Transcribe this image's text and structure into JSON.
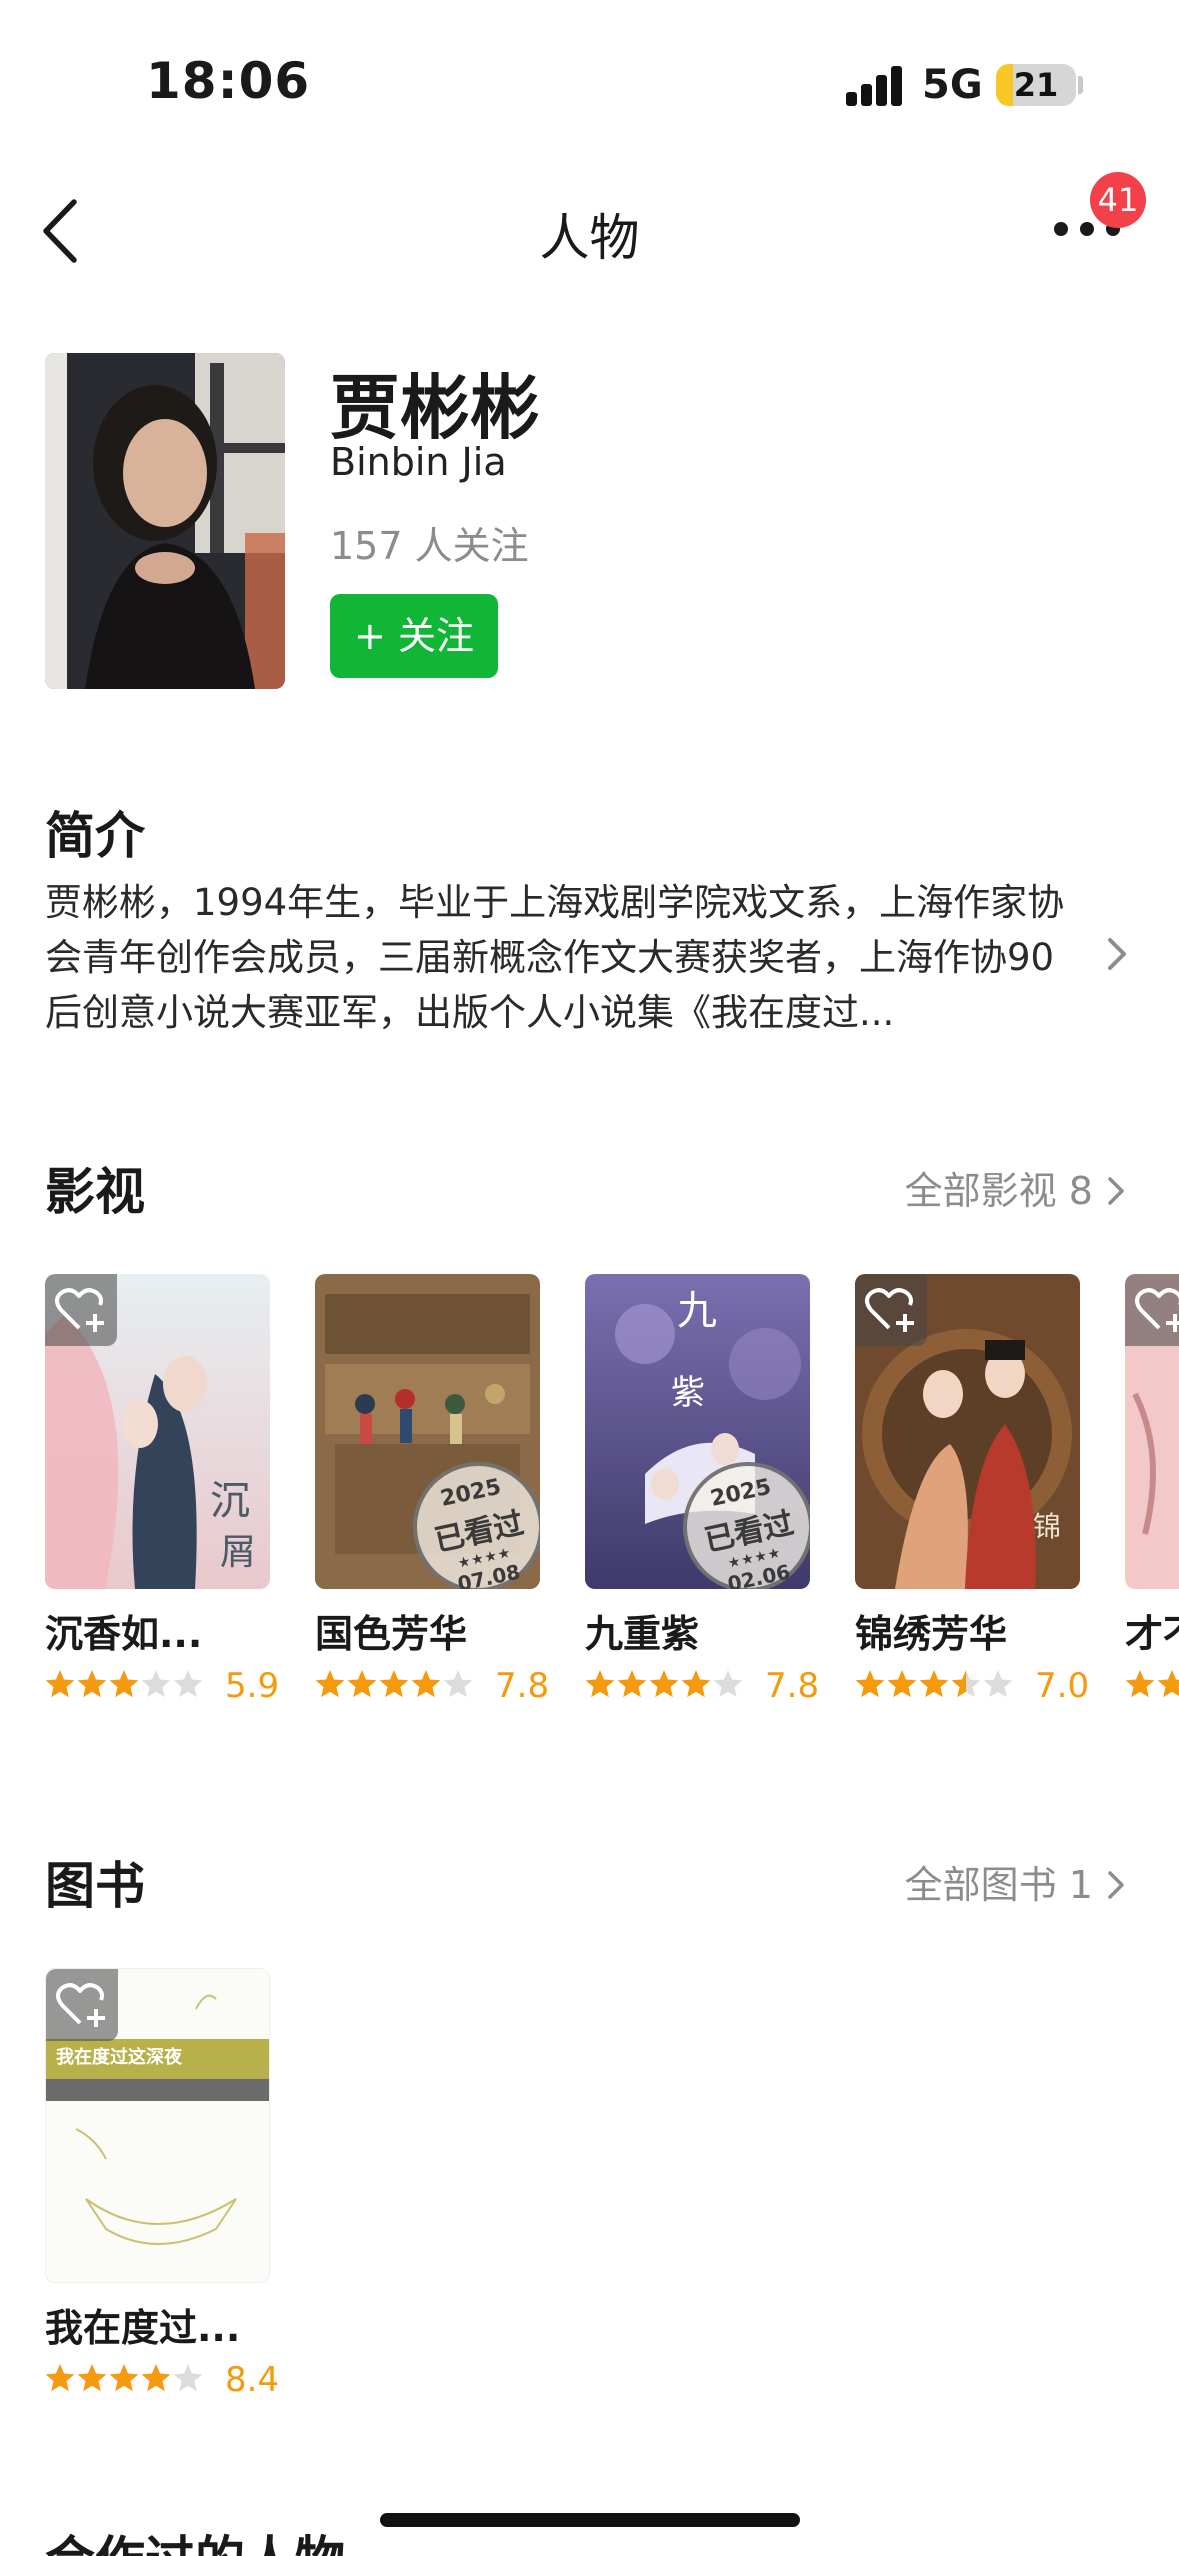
{
  "status_bar": {
    "time": "18:06",
    "network": "5G",
    "battery": "21",
    "battery_level": 0.21,
    "signal_bars": 4
  },
  "nav": {
    "title": "人物",
    "badge_count": "41"
  },
  "profile": {
    "name_cn": "贾彬彬",
    "name_en": "Binbin Jia",
    "followers": "157 人关注",
    "follow_label": "+ 关注"
  },
  "intro": {
    "title": "简介",
    "text": "贾彬彬，1994年生，毕业于上海戏剧学院戏文系，上海作家协会青年创作会成员，三届新概念作文大赛获奖者，上海作协90后创意小说大赛亚军，出版个人小说集《我在度过..."
  },
  "films": {
    "title": "影视",
    "all_label": "全部影视 8",
    "items": [
      {
        "title": "沉香如...",
        "rating": "5.9",
        "stars": 3,
        "seen": null
      },
      {
        "title": "国色芳华",
        "rating": "7.8",
        "stars": 4,
        "seen": {
          "year": "2025",
          "label": "已看过",
          "date": "07.08"
        }
      },
      {
        "title": "九重紫",
        "rating": "7.8",
        "stars": 4,
        "seen": {
          "year": "2025",
          "label": "已看过",
          "date": "02.06"
        }
      },
      {
        "title": "锦绣芳华",
        "rating": "7.0",
        "stars": 3.5,
        "seen": null
      },
      {
        "title": "才不",
        "rating": "",
        "stars": 3,
        "seen": null
      }
    ]
  },
  "books": {
    "title": "图书",
    "all_label": "全部图书 1",
    "items": [
      {
        "title": "我在度过...",
        "rating": "8.4",
        "stars": 4,
        "cover_text": "我在度过这深夜"
      }
    ]
  },
  "next_section": {
    "title": "合作过的人物"
  },
  "colors": {
    "follow": "#12b637",
    "star": "#f59a0c",
    "star_empty": "#dcdcdc",
    "badge": "#f2414a",
    "battery": "#f7c726"
  }
}
